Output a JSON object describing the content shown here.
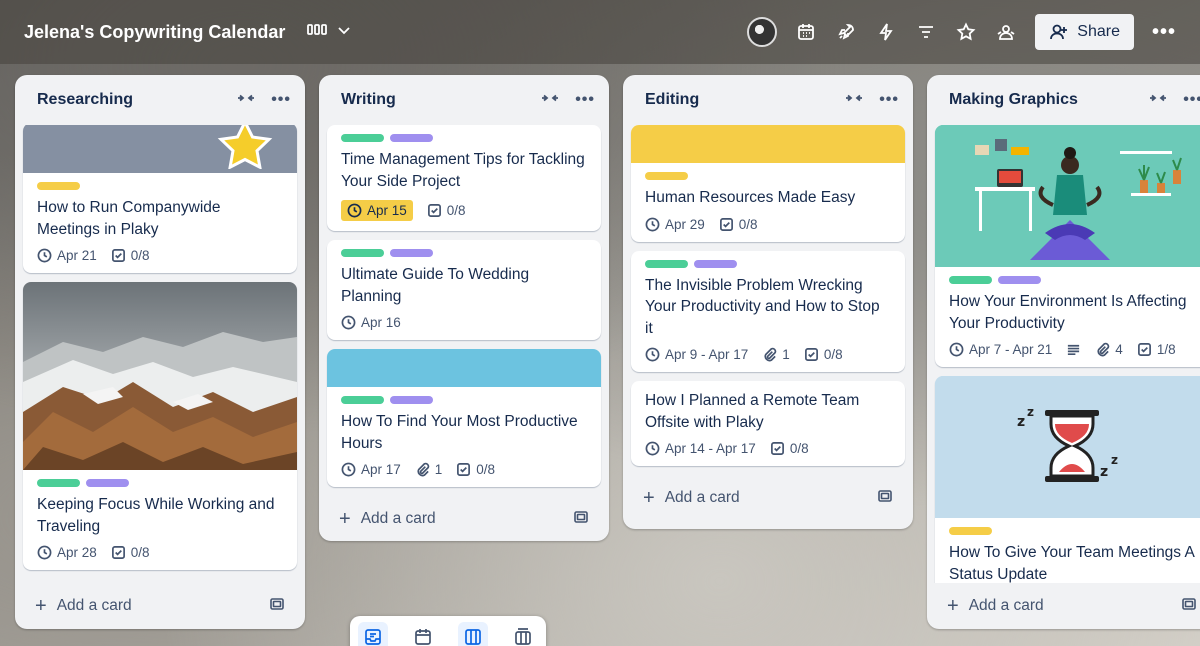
{
  "header": {
    "title": "Jelena's Copywriting Calendar",
    "share_label": "Share"
  },
  "colors": {
    "label_green": "#4bce97",
    "label_purple": "#9f8fef",
    "label_yellow": "#f5cd47",
    "cover_yellow": "#f5cd47",
    "cover_blue": "#6cc3e0",
    "cover_lightblue": "#c2dcec",
    "cover_teal": "#6ccab8"
  },
  "lists": [
    {
      "title": "Researching",
      "add_label": "Add a card",
      "cards": [
        {
          "title": "How to Run Companywide Meetings in Plaky",
          "due": "Apr 21",
          "checklist": "0/8"
        },
        {
          "title": "Keeping Focus While Working and Traveling",
          "due": "Apr 28",
          "checklist": "0/8"
        }
      ]
    },
    {
      "title": "Writing",
      "add_label": "Add a card",
      "cards": [
        {
          "title": "Time Management Tips for Tackling Your Side Project",
          "due": "Apr 15",
          "checklist": "0/8"
        },
        {
          "title": "Ultimate Guide To Wedding Planning",
          "due": "Apr 16"
        },
        {
          "title": "How To Find Your Most Productive Hours",
          "due": "Apr 17",
          "attachments": "1",
          "checklist": "0/8"
        }
      ]
    },
    {
      "title": "Editing",
      "add_label": "Add a card",
      "cards": [
        {
          "title": "Human Resources Made Easy",
          "due": "Apr 29",
          "checklist": "0/8"
        },
        {
          "title": "The Invisible Problem Wrecking Your Productivity and How to Stop it",
          "due": "Apr 9 - Apr 17",
          "attachments": "1",
          "checklist": "0/8"
        },
        {
          "title": "How I Planned a Remote Team Offsite with Plaky",
          "due": "Apr 14 - Apr 17",
          "checklist": "0/8"
        }
      ]
    },
    {
      "title": "Making Graphics",
      "add_label": "Add a card",
      "cards": [
        {
          "title": "How Your Environment Is Affecting Your Productivity",
          "due": "Apr 7 - Apr 21",
          "attachments": "4",
          "checklist": "1/8"
        },
        {
          "title": "How To Give Your Team Meetings A Status Update"
        }
      ]
    }
  ]
}
